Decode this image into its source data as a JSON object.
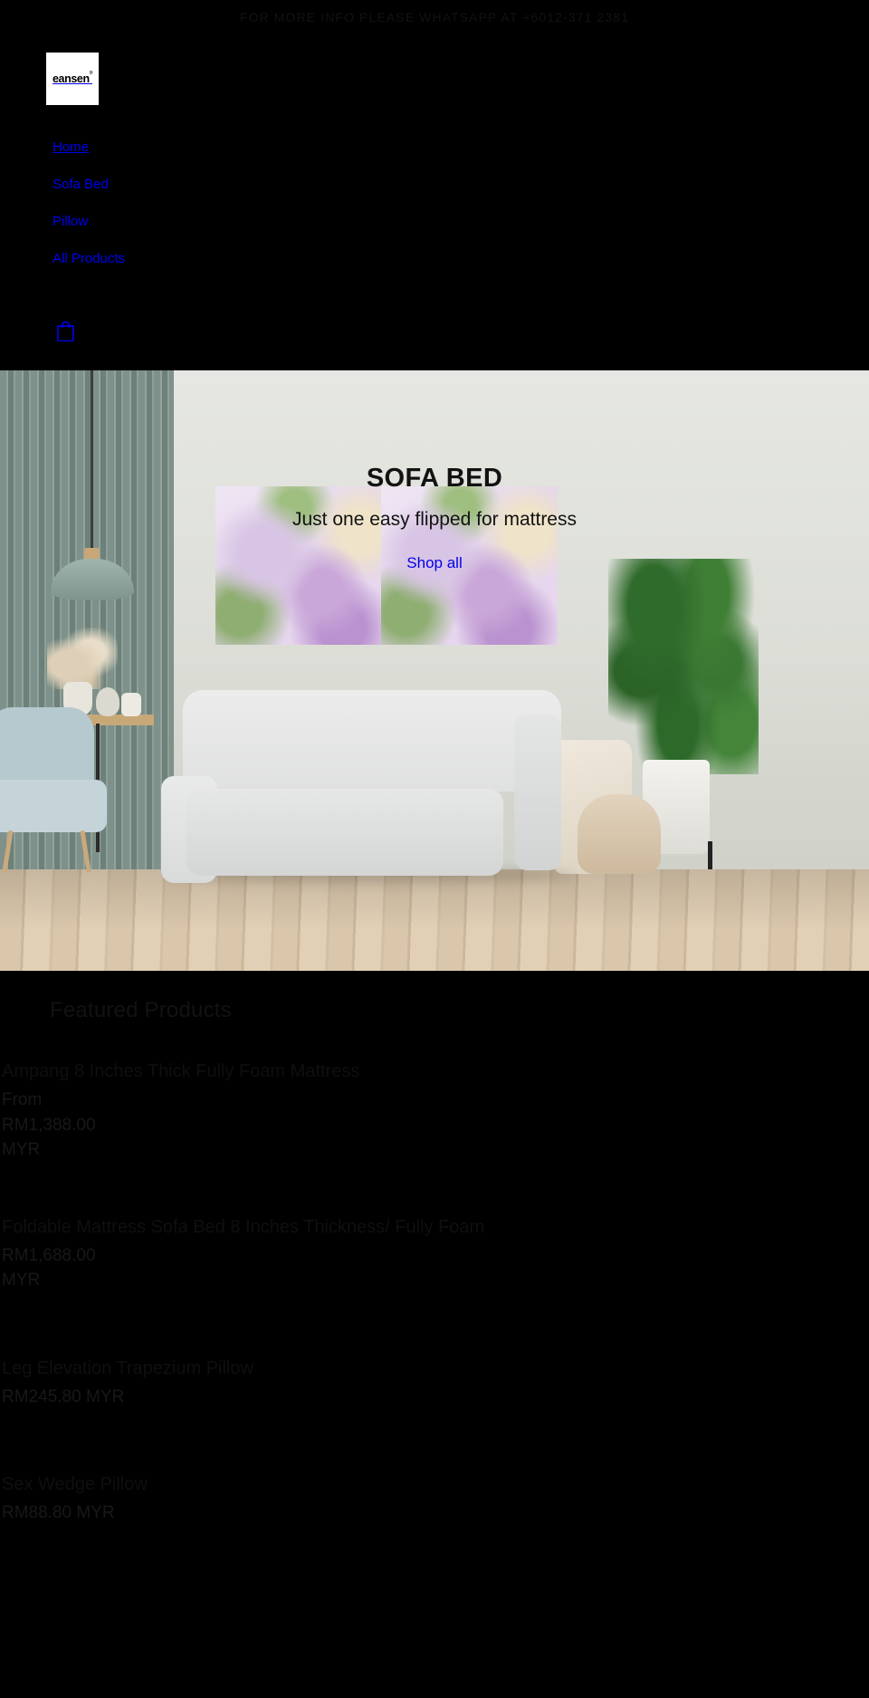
{
  "announcement": {
    "text": "FOR MORE INFO PLEASE WHATSAPP AT +6012-371 2381"
  },
  "header": {
    "logo_text": "eansen",
    "logo_trademark": "®",
    "nav": [
      {
        "label": "Home",
        "current": true
      },
      {
        "label": "Sofa Bed",
        "current": false
      },
      {
        "label": "Pillow",
        "current": false
      },
      {
        "label": "All Products",
        "current": false
      }
    ],
    "cart_icon": "shopping-bag-icon"
  },
  "hero": {
    "title": "SOFA BED",
    "subtitle": "Just one easy flipped for mattress",
    "cta_label": "Shop all"
  },
  "featured": {
    "section_title": "Featured Products",
    "products": [
      {
        "title": "Ampang 8 Inches Thick Fully Foam Mattress",
        "price": "From RM1,388.00 MYR"
      },
      {
        "title": "Foldable Mattress Sofa Bed 8 Inches Thickness/ Fully Foam",
        "price": "RM1,688.00 MYR"
      },
      {
        "title": "Leg Elevation Trapezium Pillow",
        "price": "RM245.80 MYR"
      },
      {
        "title": "Sex Wedge Pillow",
        "price": "RM88.80 MYR"
      }
    ]
  },
  "colors": {
    "background": "#000000",
    "link": "#0000ee",
    "announcement_text": "#121212",
    "hero_text": "#121212"
  }
}
